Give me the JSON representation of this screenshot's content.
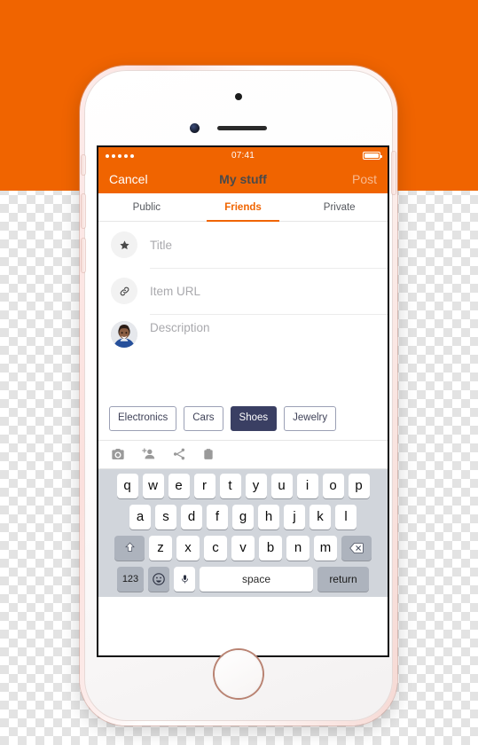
{
  "theme": {
    "brand_orange": "#F06400",
    "chip_selected": "#3A3F63",
    "keyboard_bg": "#D1D5DB"
  },
  "status_bar": {
    "signal_dots": 5,
    "time": "07:41",
    "battery_icon": "battery-full-icon"
  },
  "nav_bar": {
    "cancel_label": "Cancel",
    "title": "My stuff",
    "post_label": "Post"
  },
  "tabs": [
    {
      "label": "Public",
      "active": false
    },
    {
      "label": "Friends",
      "active": true
    },
    {
      "label": "Private",
      "active": false
    }
  ],
  "form": {
    "fields": [
      {
        "icon": "star-icon",
        "placeholder": "Title"
      },
      {
        "icon": "link-icon",
        "placeholder": "Item URL"
      },
      {
        "icon": "avatar-photo",
        "placeholder": "Description"
      }
    ]
  },
  "chips": [
    {
      "label": "Electronics",
      "selected": false
    },
    {
      "label": "Cars",
      "selected": false
    },
    {
      "label": "Shoes",
      "selected": true
    },
    {
      "label": "Jewelry",
      "selected": false
    }
  ],
  "action_bar": {
    "icons": [
      "camera-icon",
      "person-add-icon",
      "share-icon",
      "clipboard-icon"
    ]
  },
  "keyboard": {
    "row1": [
      "q",
      "w",
      "e",
      "r",
      "t",
      "y",
      "u",
      "i",
      "o",
      "p"
    ],
    "row2": [
      "a",
      "s",
      "d",
      "f",
      "g",
      "h",
      "j",
      "k",
      "l"
    ],
    "row3": [
      "z",
      "x",
      "c",
      "v",
      "b",
      "n",
      "m"
    ],
    "shift_icon": "shift-up-icon",
    "backspace_icon": "backspace-icon",
    "numeric_label": "123",
    "emoji_icon": "smiley-icon",
    "mic_icon": "microphone-icon",
    "space_label": "space",
    "return_label": "return"
  },
  "device": {
    "camera": "front-camera",
    "sensor": "proximity-sensor",
    "speaker": "earpiece-speaker",
    "home_button": "home-button"
  }
}
